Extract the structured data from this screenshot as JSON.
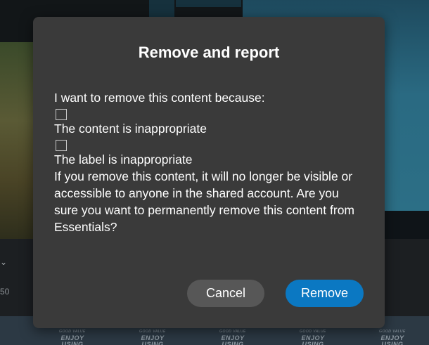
{
  "background": {
    "watermark_top": "GOOD VALUE",
    "watermark_text": "ENJOY USING",
    "left_number": "50",
    "chevron_icon": "chevron-down-icon"
  },
  "dialog": {
    "title": "Remove and report",
    "prompt": "I want to remove this content because:",
    "options": [
      {
        "label": "The content is inappropriate",
        "checked": false
      },
      {
        "label": "The label is inappropriate",
        "checked": false
      }
    ],
    "warning": "If you remove this content, it will no longer be visible or accessible to anyone in the shared account. Are you sure you want to permanently remove this content from Essentials?",
    "cancel_label": "Cancel",
    "remove_label": "Remove"
  },
  "colors": {
    "dialog_bg": "#3a3a3a",
    "cancel_bg": "#575757",
    "primary": "#0b78c2",
    "text": "#ffffff"
  }
}
